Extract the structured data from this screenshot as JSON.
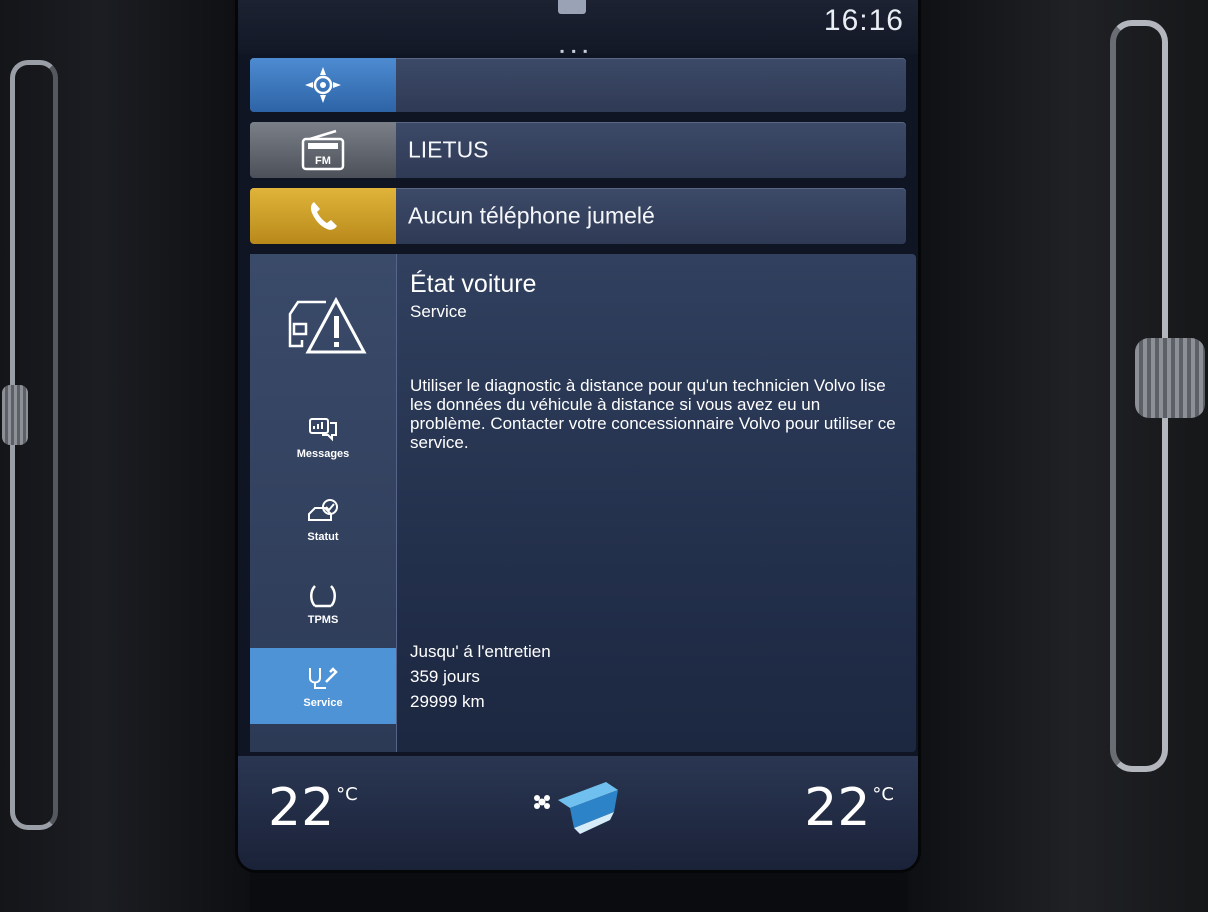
{
  "status": {
    "clock": "16:16"
  },
  "tiles": {
    "navigation": {
      "label": ""
    },
    "radio": {
      "label": "LIETUS"
    },
    "phone": {
      "label": "Aucun téléphone jumelé"
    }
  },
  "car_status": {
    "title": "État voiture",
    "subtitle": "Service",
    "description": "Utiliser le diagnostic à distance pour qu'un technicien Volvo lise les données du véhicule à distance si vous avez eu un problème. Contacter votre concessionnaire Volvo pour utiliser ce service.",
    "service_due_label": "Jusqu' á l'entretien",
    "days_remaining": "359 jours",
    "km_remaining": "29999 km",
    "nav": [
      {
        "label": "Messages",
        "icon": "messages-icon"
      },
      {
        "label": "Statut",
        "icon": "car-status-icon"
      },
      {
        "label": "TPMS",
        "icon": "tire-icon"
      },
      {
        "label": "Service",
        "icon": "service-icon",
        "selected": true
      }
    ]
  },
  "climate": {
    "temp_left": "22",
    "temp_right": "22",
    "unit": "°C"
  },
  "colors": {
    "nav_accent": "#3f7cc4",
    "phone_accent": "#d1a22a",
    "selected_tab": "#4d93d6"
  }
}
